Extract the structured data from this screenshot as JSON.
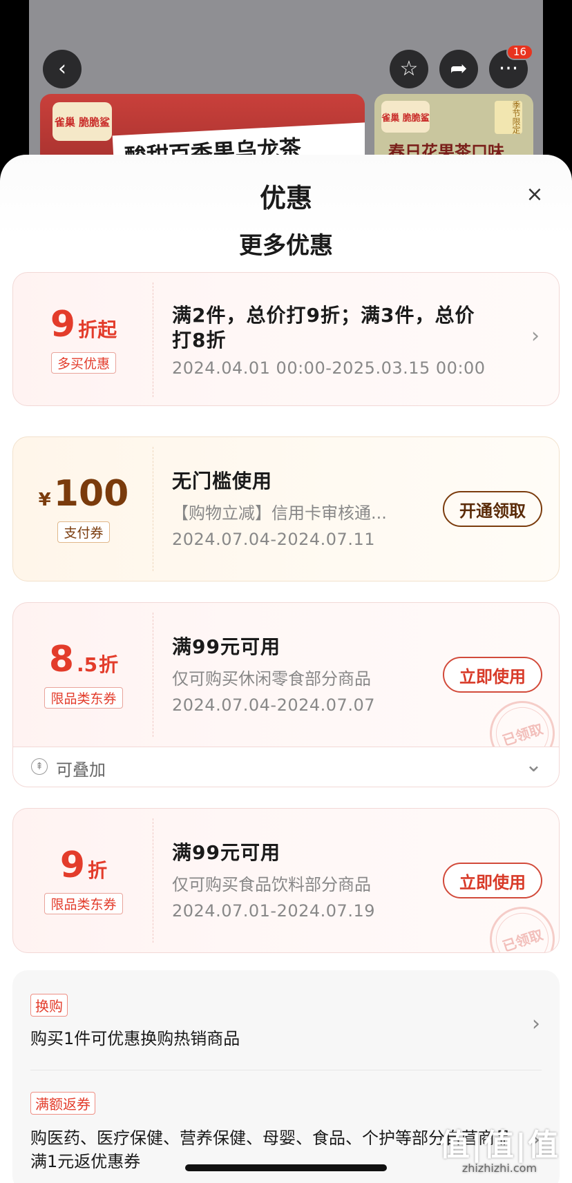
{
  "background": {
    "share_badge_count": "16",
    "banner_left": {
      "brand": "雀巢 脆脆鲨",
      "slogan": "酸甜百香果乌龙茶"
    },
    "banner_right": {
      "brand": "雀巢 脆脆鲨",
      "slogan": "春日花果茶口味",
      "tag": "季节限定"
    }
  },
  "sheet": {
    "title": "优惠",
    "section_title": "更多优惠",
    "coupons": [
      {
        "amount": "9",
        "suffix": "折起",
        "tag": "多买优惠",
        "title_line1": "满2件，总价打9折；满3件，总价",
        "title_line2": "打8折",
        "date": "2024.04.01 00:00-2025.03.15 00:00"
      },
      {
        "currency": "¥",
        "amount": "100",
        "tag": "支付券",
        "title": "无门槛使用",
        "desc": "【购物立减】信用卡审核通...",
        "date": "2024.07.04-2024.07.11",
        "action": "开通领取"
      },
      {
        "amount": "8",
        "decimal": ".5",
        "suffix": "折",
        "tag": "限品类东券",
        "title": "满99元可用",
        "desc": "仅可购买休闲零食部分商品",
        "date": "2024.07.04-2024.07.07",
        "action": "立即使用",
        "stamp": "已领取"
      },
      {
        "amount": "9",
        "suffix": "折",
        "tag": "限品类东券",
        "title": "满99元可用",
        "desc": "仅可购买食品饮料部分商品",
        "date": "2024.07.01-2024.07.19",
        "action": "立即使用",
        "stamp": "已领取"
      }
    ],
    "stackable_label": "可叠加",
    "promotions": [
      {
        "tag": "换购",
        "text": "购买1件可优惠换购热销商品"
      },
      {
        "tag": "满额返券",
        "text": "购医药、医疗保健、营养保健、母婴、食品、个护等部分自营商品满1元返优惠券"
      }
    ]
  },
  "watermark": {
    "big": "值|值|值",
    "small": "zhizhizhi.com"
  }
}
